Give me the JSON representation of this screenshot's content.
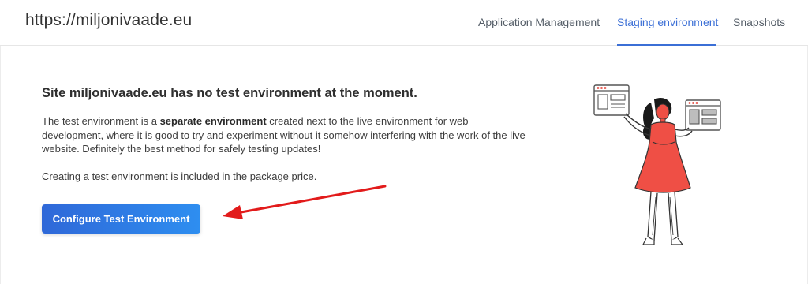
{
  "header": {
    "site_url": "https://miljonivaade.eu",
    "tabs": [
      {
        "label": "Application Management",
        "active": false
      },
      {
        "label": "Staging environment",
        "active": true
      },
      {
        "label": "Snapshots",
        "active": false
      }
    ]
  },
  "main": {
    "headline": "Site miljonivaade.eu has no test environment at the moment.",
    "description": {
      "pre": "The test environment is a ",
      "bold": "separate environment",
      "post": " created next to the live environment for web development, where it is good to try and experiment without it somehow interfering with the work of the live website. Definitely the best method for safely testing updates!"
    },
    "note": "Creating a test environment is included in the package price.",
    "cta_label": "Configure Test Environment"
  },
  "colors": {
    "accent": "#3b6fd6",
    "button_start": "#2f68d8",
    "button_end": "#2e8ef0",
    "arrow": "#e21b1b",
    "illustration_dress": "#ef4f45"
  },
  "icons": {
    "annotation_arrow": "red-arrow-icon",
    "illustration": "woman-with-browser-windows-illustration"
  }
}
